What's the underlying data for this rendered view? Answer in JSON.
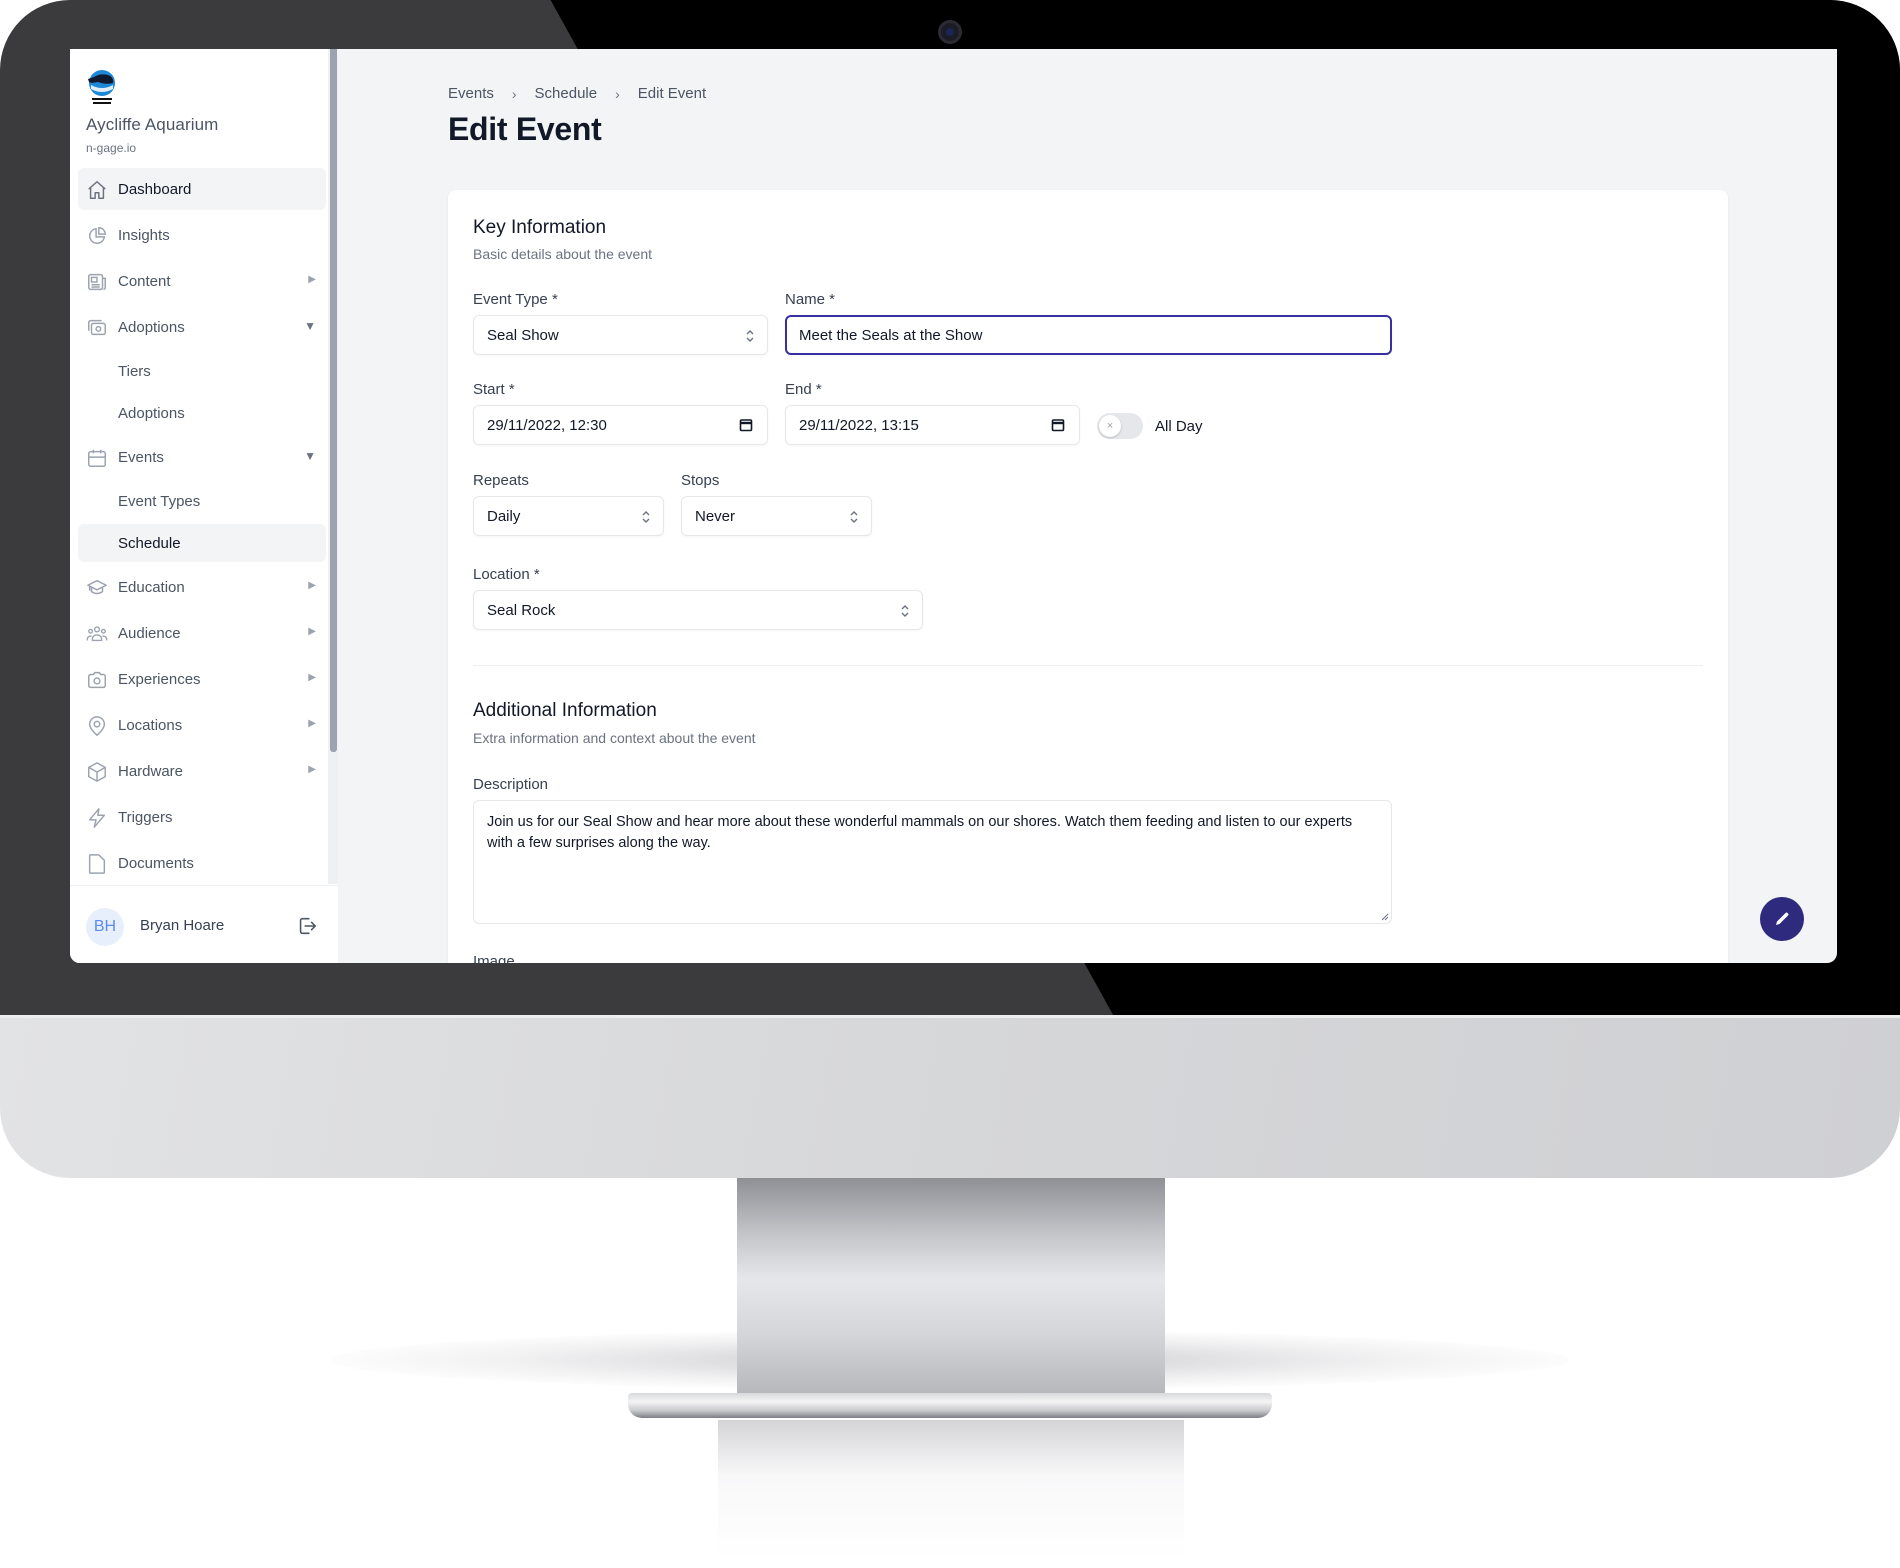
{
  "app": {
    "org_name": "Aycliffe Aquarium",
    "org_domain": "n-gage.io",
    "logo_label": "AYCLIFFE AQUARIUM"
  },
  "sidebar": {
    "items": [
      {
        "label": "Dashboard",
        "icon": "home-icon",
        "active": true
      },
      {
        "label": "Insights",
        "icon": "chart-pie-icon"
      },
      {
        "label": "Content",
        "icon": "newspaper-icon",
        "caret": "right"
      },
      {
        "label": "Adoptions",
        "icon": "photo-camera-stack-icon",
        "caret": "down",
        "children": [
          {
            "label": "Tiers"
          },
          {
            "label": "Adoptions"
          }
        ]
      },
      {
        "label": "Events",
        "icon": "calendar-icon",
        "caret": "down",
        "children": [
          {
            "label": "Event Types"
          },
          {
            "label": "Schedule",
            "current": true
          }
        ]
      },
      {
        "label": "Education",
        "icon": "academic-cap-icon",
        "caret": "right"
      },
      {
        "label": "Audience",
        "icon": "user-group-icon",
        "caret": "right"
      },
      {
        "label": "Experiences",
        "icon": "camera-icon",
        "caret": "right"
      },
      {
        "label": "Locations",
        "icon": "map-pin-icon",
        "caret": "right"
      },
      {
        "label": "Hardware",
        "icon": "cube-icon",
        "caret": "right"
      },
      {
        "label": "Triggers",
        "icon": "bolt-icon"
      },
      {
        "label": "Documents",
        "icon": "document-icon"
      }
    ],
    "caret_right": "▶",
    "caret_down": "▼",
    "user": {
      "initials": "BH",
      "name": "Bryan Hoare"
    }
  },
  "header": {
    "breadcrumb": [
      "Events",
      "Schedule",
      "Edit Event"
    ],
    "breadcrumb_separator": "›",
    "title": "Edit Event"
  },
  "form": {
    "key_info": {
      "title": "Key Information",
      "subtitle": "Basic details about the event",
      "event_type": {
        "label": "Event Type *",
        "value": "Seal Show"
      },
      "name": {
        "label": "Name *",
        "value": "Meet the Seals at the Show"
      },
      "start": {
        "label": "Start *",
        "value": "29/11/2022, 12:30"
      },
      "end": {
        "label": "End *",
        "value": "29/11/2022, 13:15"
      },
      "all_day": {
        "label": "All Day",
        "checked": false,
        "knob_glyph": "×"
      },
      "repeats": {
        "label": "Repeats",
        "value": "Daily"
      },
      "stops": {
        "label": "Stops",
        "value": "Never"
      },
      "location": {
        "label": "Location *",
        "value": "Seal Rock"
      }
    },
    "additional_info": {
      "title": "Additional Information",
      "subtitle": "Extra information and context about the event",
      "description": {
        "label": "Description",
        "value": "Join us for our Seal Show and hear more about these wonderful mammals on our shores. Watch them feeding and listen to our experts with a few surprises along the way."
      },
      "image": {
        "label": "Image"
      }
    }
  },
  "fab": {
    "icon": "pencil-icon"
  },
  "colors": {
    "accent": "#2e2a7d",
    "focus_border": "#3730a3",
    "page_bg": "#f3f4f6",
    "avatar_bg": "#e8effc",
    "avatar_text": "#5b8def"
  }
}
